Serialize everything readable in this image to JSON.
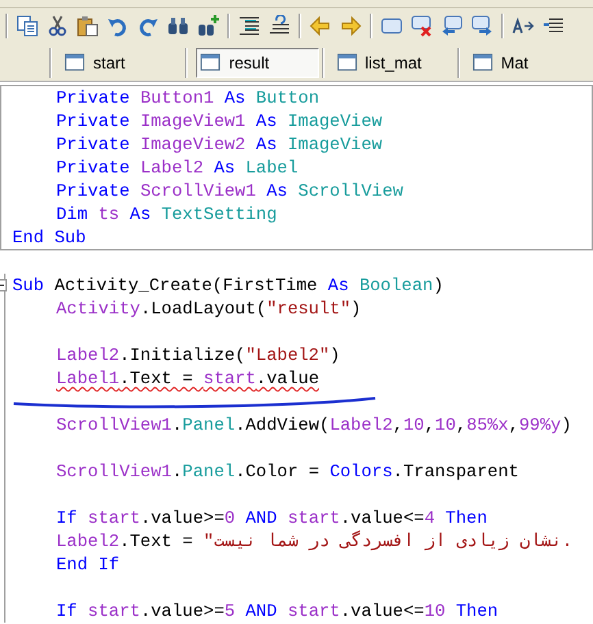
{
  "tabs": [
    {
      "label": "start",
      "selected": false
    },
    {
      "label": "result",
      "selected": true
    },
    {
      "label": "list_mat",
      "selected": false
    },
    {
      "label": "Mat",
      "selected": false
    }
  ],
  "blocks": [
    {
      "kind": "framed",
      "lines": [
        {
          "kind": "code",
          "indent": true,
          "foldable": false,
          "error": false,
          "tokens": [
            {
              "text": "Private ",
              "kind": "keyword"
            },
            {
              "text": "Button1 ",
              "kind": "identifier"
            },
            {
              "text": "As ",
              "kind": "keyword"
            },
            {
              "text": "Button",
              "kind": "type"
            }
          ]
        },
        {
          "kind": "code",
          "indent": true,
          "foldable": false,
          "error": false,
          "tokens": [
            {
              "text": "Private ",
              "kind": "keyword"
            },
            {
              "text": "ImageView1 ",
              "kind": "identifier"
            },
            {
              "text": "As ",
              "kind": "keyword"
            },
            {
              "text": "ImageView",
              "kind": "type"
            }
          ]
        },
        {
          "kind": "code",
          "indent": true,
          "foldable": false,
          "error": false,
          "tokens": [
            {
              "text": "Private ",
              "kind": "keyword"
            },
            {
              "text": "ImageView2 ",
              "kind": "identifier"
            },
            {
              "text": "As ",
              "kind": "keyword"
            },
            {
              "text": "ImageView",
              "kind": "type"
            }
          ]
        },
        {
          "kind": "code",
          "indent": true,
          "foldable": false,
          "error": false,
          "tokens": [
            {
              "text": "Private ",
              "kind": "keyword"
            },
            {
              "text": "Label2 ",
              "kind": "identifier"
            },
            {
              "text": "As ",
              "kind": "keyword"
            },
            {
              "text": "Label",
              "kind": "type"
            }
          ]
        },
        {
          "kind": "code",
          "indent": true,
          "foldable": false,
          "error": false,
          "tokens": [
            {
              "text": "Private ",
              "kind": "keyword"
            },
            {
              "text": "ScrollView1 ",
              "kind": "identifier"
            },
            {
              "text": "As ",
              "kind": "keyword"
            },
            {
              "text": "ScrollView",
              "kind": "type"
            }
          ]
        },
        {
          "kind": "code",
          "indent": true,
          "foldable": false,
          "error": false,
          "tokens": [
            {
              "text": "Dim ",
              "kind": "keyword"
            },
            {
              "text": "ts ",
              "kind": "identifier"
            },
            {
              "text": "As ",
              "kind": "keyword"
            },
            {
              "text": "TextSetting",
              "kind": "type"
            }
          ]
        },
        {
          "kind": "code",
          "indent": false,
          "foldable": false,
          "error": false,
          "tokens": [
            {
              "text": "End Sub",
              "kind": "keyword"
            }
          ]
        }
      ]
    },
    {
      "kind": "gutter",
      "lines": [
        {
          "kind": "code",
          "indent": false,
          "foldable": true,
          "error": false,
          "tokens": [
            {
              "text": "Sub ",
              "kind": "keyword"
            },
            {
              "text": "Activity_Create(FirstTime ",
              "kind": "plain"
            },
            {
              "text": "As ",
              "kind": "keyword"
            },
            {
              "text": "Boolean",
              "kind": "type"
            },
            {
              "text": ")",
              "kind": "plain"
            }
          ]
        },
        {
          "kind": "code",
          "indent": true,
          "foldable": false,
          "error": false,
          "tokens": [
            {
              "text": "Activity",
              "kind": "identifier"
            },
            {
              "text": ".LoadLayout(",
              "kind": "plain"
            },
            {
              "text": "\"result\"",
              "kind": "string"
            },
            {
              "text": ")",
              "kind": "plain"
            }
          ]
        },
        {
          "kind": "blank"
        },
        {
          "kind": "code",
          "indent": true,
          "foldable": false,
          "error": false,
          "tokens": [
            {
              "text": "Label2",
              "kind": "identifier"
            },
            {
              "text": ".Initialize(",
              "kind": "plain"
            },
            {
              "text": "\"Label2\"",
              "kind": "string"
            },
            {
              "text": ")",
              "kind": "plain"
            }
          ]
        },
        {
          "kind": "code",
          "indent": true,
          "foldable": false,
          "error": true,
          "tokens": [
            {
              "text": "Label1",
              "kind": "identifier"
            },
            {
              "text": ".Text = ",
              "kind": "plain"
            },
            {
              "text": "start",
              "kind": "identifier"
            },
            {
              "text": ".value",
              "kind": "plain"
            }
          ]
        },
        {
          "kind": "ink"
        },
        {
          "kind": "code",
          "indent": true,
          "foldable": false,
          "error": false,
          "tokens": [
            {
              "text": "ScrollView1",
              "kind": "identifier"
            },
            {
              "text": ".",
              "kind": "plain"
            },
            {
              "text": "Panel",
              "kind": "type"
            },
            {
              "text": ".AddView(",
              "kind": "plain"
            },
            {
              "text": "Label2",
              "kind": "identifier"
            },
            {
              "text": ",",
              "kind": "plain"
            },
            {
              "text": "10",
              "kind": "number"
            },
            {
              "text": ",",
              "kind": "plain"
            },
            {
              "text": "10",
              "kind": "number"
            },
            {
              "text": ",",
              "kind": "plain"
            },
            {
              "text": "85%x",
              "kind": "number"
            },
            {
              "text": ",",
              "kind": "plain"
            },
            {
              "text": "99%y",
              "kind": "number"
            },
            {
              "text": ")",
              "kind": "plain"
            }
          ]
        },
        {
          "kind": "blank"
        },
        {
          "kind": "code",
          "indent": true,
          "foldable": false,
          "error": false,
          "tokens": [
            {
              "text": "ScrollView1",
              "kind": "identifier"
            },
            {
              "text": ".",
              "kind": "plain"
            },
            {
              "text": "Panel",
              "kind": "type"
            },
            {
              "text": ".Color = ",
              "kind": "plain"
            },
            {
              "text": "Colors",
              "kind": "keyword"
            },
            {
              "text": ".Transparent",
              "kind": "plain"
            }
          ]
        },
        {
          "kind": "blank"
        },
        {
          "kind": "code",
          "indent": true,
          "foldable": false,
          "error": false,
          "tokens": [
            {
              "text": "If ",
              "kind": "keyword"
            },
            {
              "text": "start",
              "kind": "identifier"
            },
            {
              "text": ".value>=",
              "kind": "plain"
            },
            {
              "text": "0 ",
              "kind": "number"
            },
            {
              "text": "AND ",
              "kind": "keyword"
            },
            {
              "text": "start",
              "kind": "identifier"
            },
            {
              "text": ".value<=",
              "kind": "plain"
            },
            {
              "text": "4 ",
              "kind": "number"
            },
            {
              "text": "Then",
              "kind": "keyword"
            }
          ]
        },
        {
          "kind": "code",
          "indent": true,
          "foldable": false,
          "error": false,
          "tokens": [
            {
              "text": "Label2",
              "kind": "identifier"
            },
            {
              "text": ".Text = ",
              "kind": "plain"
            },
            {
              "text": "\"نشان زیادی از افسردگی در شما نیست.",
              "kind": "string"
            }
          ]
        },
        {
          "kind": "code",
          "indent": true,
          "foldable": false,
          "error": false,
          "tokens": [
            {
              "text": "End If",
              "kind": "keyword"
            }
          ]
        },
        {
          "kind": "blank"
        },
        {
          "kind": "code",
          "indent": true,
          "foldable": false,
          "error": false,
          "tokens": [
            {
              "text": "If ",
              "kind": "keyword"
            },
            {
              "text": "start",
              "kind": "identifier"
            },
            {
              "text": ".value>=",
              "kind": "plain"
            },
            {
              "text": "5 ",
              "kind": "number"
            },
            {
              "text": "AND ",
              "kind": "keyword"
            },
            {
              "text": "start",
              "kind": "identifier"
            },
            {
              "text": ".value<=",
              "kind": "plain"
            },
            {
              "text": "10 ",
              "kind": "number"
            },
            {
              "text": "Then",
              "kind": "keyword"
            }
          ]
        }
      ]
    }
  ]
}
